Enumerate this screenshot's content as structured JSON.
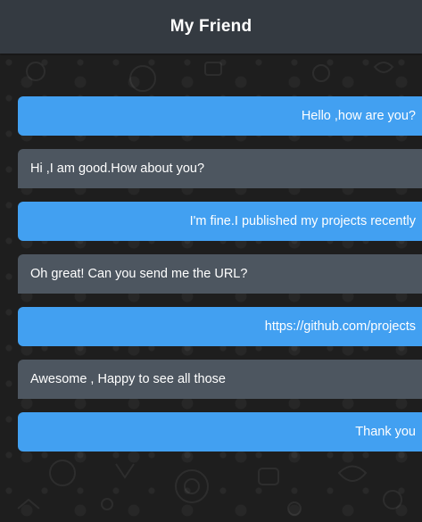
{
  "header": {
    "title": "My Friend"
  },
  "messages": [
    {
      "type": "sent",
      "text": "Hello ,how are you?"
    },
    {
      "type": "received",
      "text": "Hi ,I am good.How about you?"
    },
    {
      "type": "sent",
      "text": "I'm fine.I published my projects recently"
    },
    {
      "type": "received",
      "text": "Oh great! Can you send me the URL?"
    },
    {
      "type": "sent",
      "text": "https://github.com/projects"
    },
    {
      "type": "received",
      "text": "Awesome , Happy to see all those"
    },
    {
      "type": "sent",
      "text": "Thank you"
    }
  ],
  "colors": {
    "header_bg": "#343a41",
    "sent_bubble": "#42a0f1",
    "received_bubble": "#4d5660",
    "background": "#1e1e1e"
  }
}
